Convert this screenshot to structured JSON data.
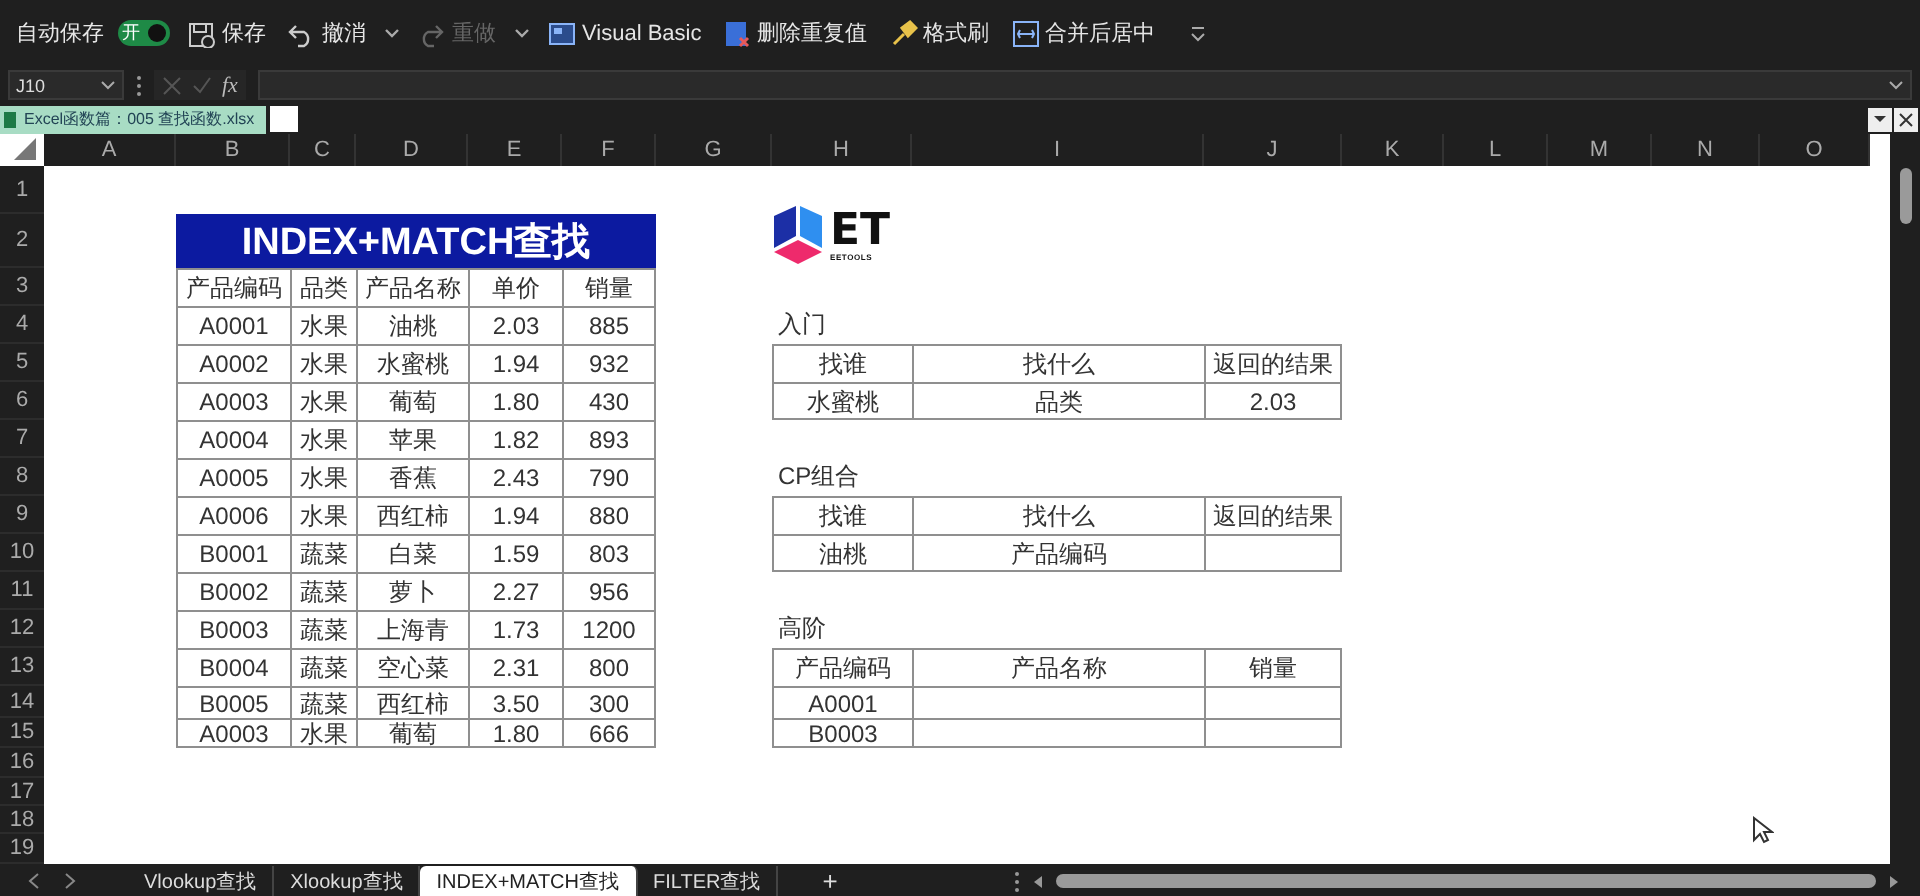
{
  "ribbon": {
    "autosave": {
      "label": "自动保存",
      "toggle_text": "开",
      "on": true
    },
    "buttons": [
      {
        "kind": "save",
        "label": "保存",
        "disabled": false,
        "dropdown": false
      },
      {
        "kind": "undo",
        "label": "撤消",
        "disabled": false,
        "dropdown": true
      },
      {
        "kind": "redo",
        "label": "重做",
        "disabled": true,
        "dropdown": true
      },
      {
        "kind": "vba",
        "label": "Visual Basic",
        "disabled": false,
        "dropdown": false
      },
      {
        "kind": "dedupe",
        "label": "删除重复值",
        "disabled": false,
        "dropdown": false
      },
      {
        "kind": "painter",
        "label": "格式刷",
        "disabled": false,
        "dropdown": false
      },
      {
        "kind": "merge",
        "label": "合并后居中",
        "disabled": false,
        "dropdown": false
      }
    ]
  },
  "formula_bar": {
    "name_box": "J10",
    "fx": "fx"
  },
  "workbook_tab": {
    "title": "Excel函数篇：005 查找函数.xlsx"
  },
  "sheet": {
    "columns": [
      "A",
      "B",
      "C",
      "D",
      "E",
      "F",
      "G",
      "H",
      "I",
      "J",
      "K",
      "L",
      "M",
      "N",
      "O"
    ],
    "rows": [
      "1",
      "2",
      "3",
      "4",
      "5",
      "6",
      "7",
      "8",
      "9",
      "10",
      "11",
      "12",
      "13",
      "14",
      "15",
      "16",
      "17",
      "18",
      "19"
    ]
  },
  "main_table": {
    "title": "INDEX+MATCH查找",
    "headers": [
      "产品编码",
      "品类",
      "产品名称",
      "单价",
      "销量"
    ],
    "rows": [
      [
        "A0001",
        "水果",
        "油桃",
        "2.03",
        "885"
      ],
      [
        "A0002",
        "水果",
        "水蜜桃",
        "1.94",
        "932"
      ],
      [
        "A0003",
        "水果",
        "葡萄",
        "1.80",
        "430"
      ],
      [
        "A0004",
        "水果",
        "苹果",
        "1.82",
        "893"
      ],
      [
        "A0005",
        "水果",
        "香蕉",
        "2.43",
        "790"
      ],
      [
        "A0006",
        "水果",
        "西红柿",
        "1.94",
        "880"
      ],
      [
        "B0001",
        "蔬菜",
        "白菜",
        "1.59",
        "803"
      ],
      [
        "B0002",
        "蔬菜",
        "萝卜",
        "2.27",
        "956"
      ],
      [
        "B0003",
        "蔬菜",
        "上海青",
        "1.73",
        "1200"
      ],
      [
        "B0004",
        "蔬菜",
        "空心菜",
        "2.31",
        "800"
      ],
      [
        "B0005",
        "蔬菜",
        "西红柿",
        "3.50",
        "300"
      ],
      [
        "A0003",
        "水果",
        "葡萄",
        "1.80",
        "666"
      ]
    ]
  },
  "logo": {
    "mark": "ET",
    "name": "EETOOLS"
  },
  "sections": [
    {
      "label": "入门",
      "headers": [
        "找谁",
        "找什么",
        "返回的结果"
      ],
      "rows": [
        [
          "水蜜桃",
          "品类",
          "2.03"
        ]
      ]
    },
    {
      "label": "CP组合",
      "headers": [
        "找谁",
        "找什么",
        "返回的结果"
      ],
      "rows": [
        [
          "油桃",
          "产品编码"
        ]
      ]
    },
    {
      "label": "高阶",
      "headers": [
        "产品编码",
        "产品名称",
        "销量"
      ],
      "rows": [
        [
          "A0001"
        ],
        [
          "B0003"
        ]
      ]
    }
  ],
  "sheet_tabs": [
    {
      "label": "Vlookup查找",
      "selected": false
    },
    {
      "label": "Xlookup查找",
      "selected": false
    },
    {
      "label": "INDEX+MATCH查找",
      "selected": true
    },
    {
      "label": "FILTER查找",
      "selected": false
    }
  ],
  "add_sheet": "+"
}
